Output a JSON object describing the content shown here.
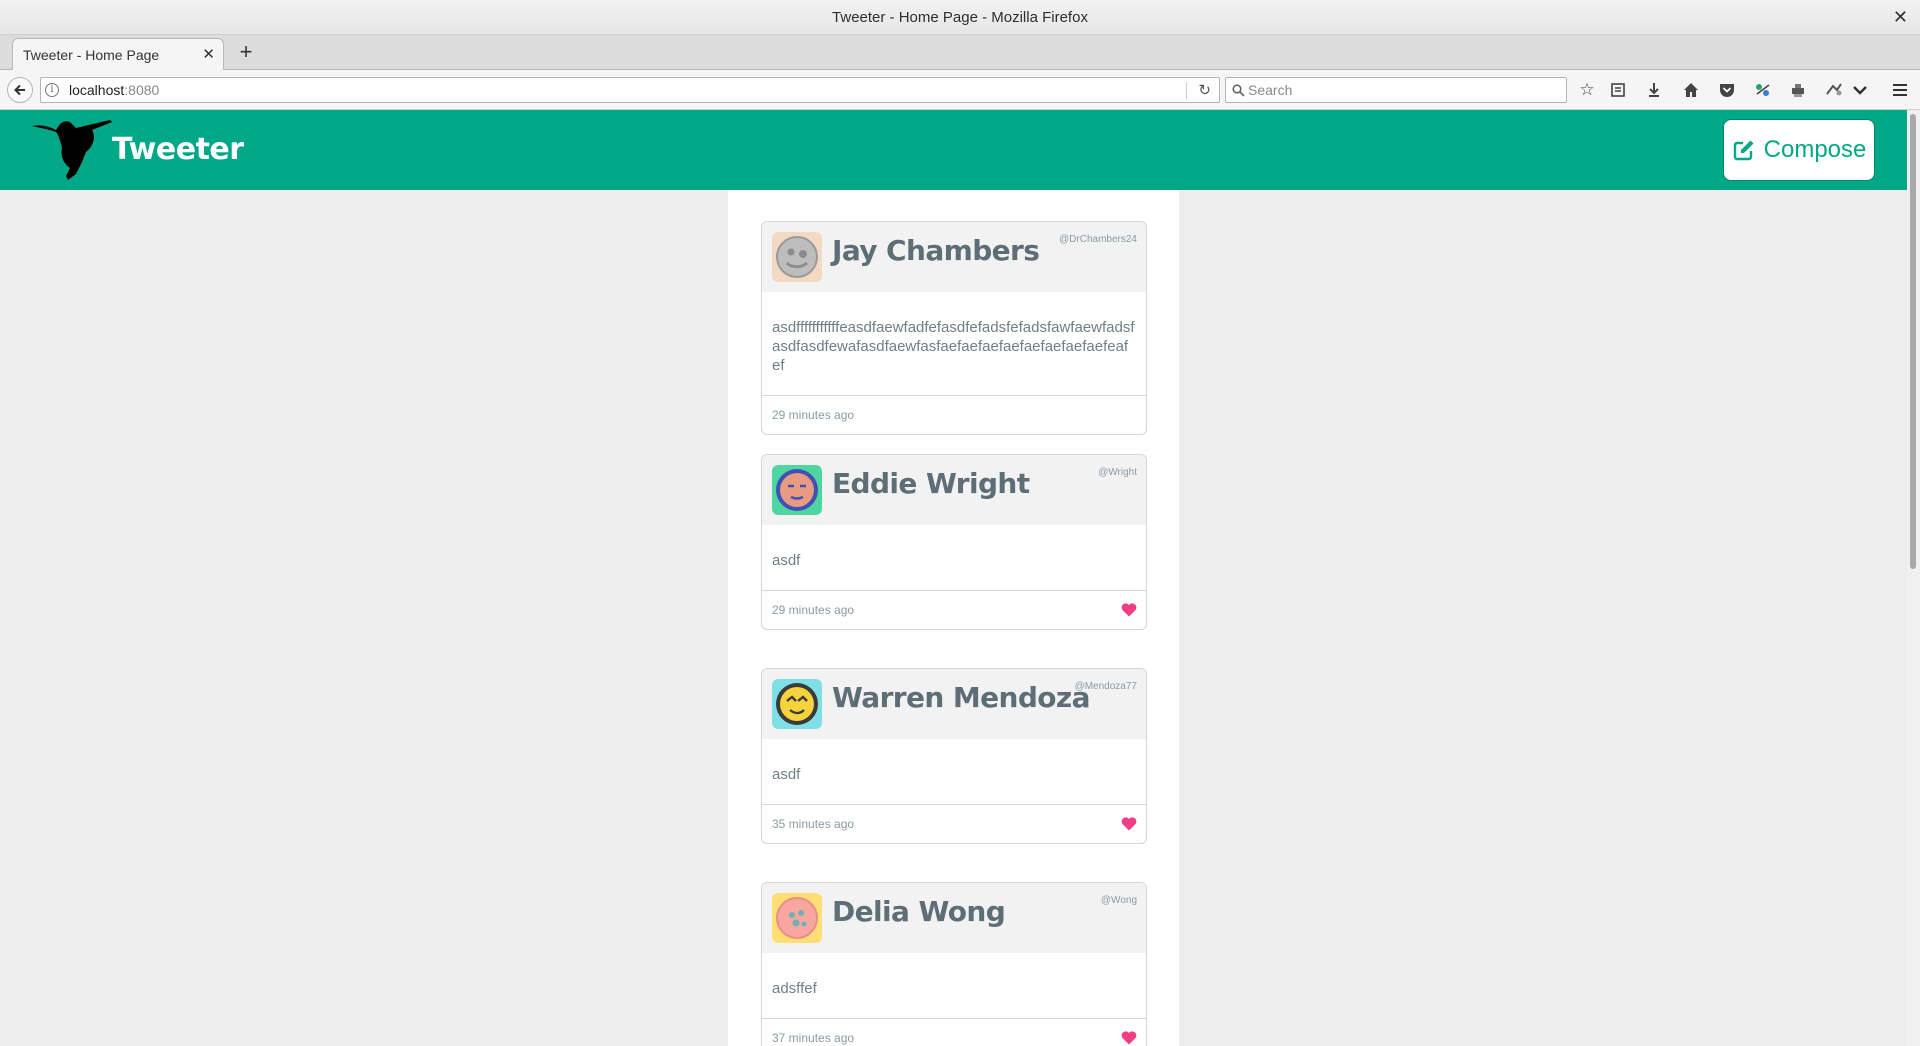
{
  "window": {
    "title": "Tweeter - Home Page - Mozilla Firefox",
    "close_glyph": "✕"
  },
  "tabs": [
    {
      "label": "Tweeter - Home Page",
      "close_glyph": "✕"
    }
  ],
  "new_tab_glyph": "+",
  "urlbar": {
    "host": "localhost",
    "port": ":8080"
  },
  "searchbar": {
    "placeholder": "Search"
  },
  "toolbar_icons": [
    "bookmark-star-icon",
    "reading-list-icon",
    "downloads-icon",
    "home-icon",
    "pocket-icon",
    "extension-icon",
    "extension-icon-2",
    "extension-icon-3",
    "overflow-chevron-icon",
    "hamburger-menu-icon"
  ],
  "app": {
    "brand": "Tweeter",
    "compose_label": "Compose",
    "accent_color": "#00a887",
    "heart_color": "#ef3d87"
  },
  "tweets": [
    {
      "name": "Jay Chambers",
      "handle": "@DrChambers24",
      "text": "asdfffffffffffeasdfaewfadfefasdfefadsfefadsfawfaewfadsfasdfasdfewafasdfaewfasfaefaefaefaefaefaefaefaefeafef",
      "time": "29 minutes ago",
      "liked": false,
      "avatar_bg": "#f2d9c2"
    },
    {
      "name": "Eddie Wright",
      "handle": "@Wright",
      "text": "asdf",
      "time": "29 minutes ago",
      "liked": true,
      "avatar_bg": "#4fd6a0"
    },
    {
      "name": "Warren Mendoza",
      "handle": "@Mendoza77",
      "text": "asdf",
      "time": "35 minutes ago",
      "liked": true,
      "avatar_bg": "#7ee0e6"
    },
    {
      "name": "Delia Wong",
      "handle": "@Wong",
      "text": "adsffef",
      "time": "37 minutes ago",
      "liked": true,
      "avatar_bg": "#ffdf73"
    }
  ]
}
